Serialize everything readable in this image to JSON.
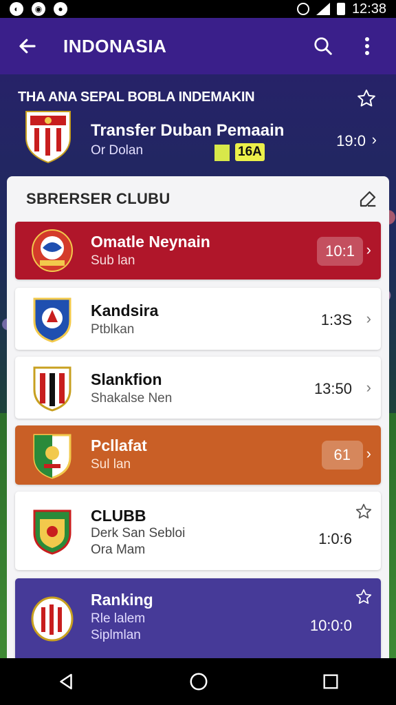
{
  "status_bar": {
    "left_icons": [
      "app-icon-1",
      "app-icon-2",
      "app-icon-3"
    ],
    "time": "12:38"
  },
  "app_bar": {
    "title": "INDONASIA",
    "back_icon": "arrow-left-icon",
    "search_icon": "search-icon",
    "more_icon": "more-vert-icon"
  },
  "featured": {
    "heading": "THA ANA SEPAL BOBLA INDEMAKIN",
    "title": "Transfer Duban Pemaain",
    "subtitle": "Or Dolan",
    "badge": "16A",
    "value": "19:0",
    "accent_color": "#ecf04a"
  },
  "card": {
    "heading": "SBRERSER CLUBU"
  },
  "rows": [
    {
      "name": "Omatle Neynain",
      "sub": "Sub lan",
      "value": "10:1",
      "bg": "#b0162a",
      "text_color": "#ffffff",
      "highlight": true
    },
    {
      "name": "Kandsira",
      "sub": "Ptblkan",
      "value": "1:3S",
      "bg": "#ffffff",
      "text_color": "#111111",
      "highlight": false
    },
    {
      "name": "Slankfion",
      "sub": "Shakalse Nen",
      "value": "13:50",
      "bg": "#ffffff",
      "text_color": "#111111",
      "highlight": false
    },
    {
      "name": "Pcllafat",
      "sub": "Sul lan",
      "value": "61",
      "bg": "#c95f26",
      "text_color": "#ffffff",
      "highlight": true
    },
    {
      "name": "CLUBB",
      "sub": "Derk San Sebloi",
      "sub2": "Ora Mam",
      "value": "1:0:6",
      "bg": "#ffffff",
      "text_color": "#111111",
      "highlight": false,
      "star": true
    },
    {
      "name": "Ranking",
      "sub": "Rle lalem",
      "sub2": "Siplmlan",
      "value": "10:0:0",
      "bg": "#463a98",
      "text_color": "#ffffff",
      "highlight": false,
      "star": true
    }
  ],
  "nav_bar": {
    "back": "nav-back-icon",
    "home": "nav-home-icon",
    "recents": "nav-recents-icon"
  }
}
